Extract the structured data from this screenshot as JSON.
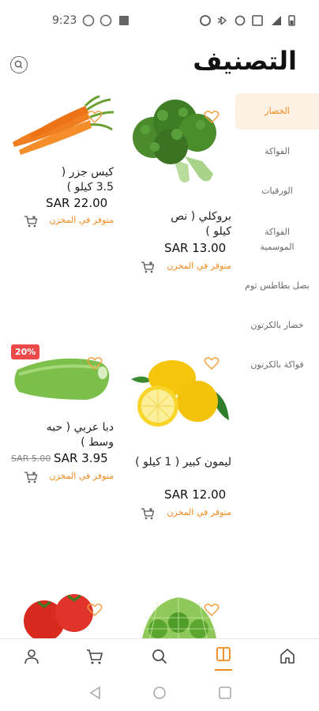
{
  "status_bar": {
    "time": "9:23"
  },
  "header": {
    "title": "التصنيف"
  },
  "categories": [
    {
      "label": "الخضار",
      "active": true
    },
    {
      "label": "الفواكة"
    },
    {
      "label": "الورقيات"
    },
    {
      "label": "الفواكة الموسمية"
    },
    {
      "label": "بصل بطاطس ثوم"
    },
    {
      "label": "خضار بالكرتون"
    },
    {
      "label": "فواكة بالكرتون"
    }
  ],
  "products": [
    {
      "name": "بروكلي ( نص كيلو )",
      "price": "SAR 13.00",
      "stock": "متوفر في المخزن"
    },
    {
      "name": "كيس جزر ( 3.5 كيلو )",
      "price": "SAR 22.00",
      "stock": "متوفر في المخزن"
    },
    {
      "name": "ليمون كبير ( 1 كيلو )",
      "price": "SAR 12.00",
      "stock": "متوفر في المخزن"
    },
    {
      "name": "دبا عربي ( حبه وسط )",
      "price": "SAR 3.95",
      "old_price": "SAR 5.00",
      "badge": "20%",
      "stock": "متوفر في المخزن"
    }
  ],
  "colors": {
    "accent": "#f08a1c",
    "badge": "#ec4a4a",
    "active_bg": "#fdf1e4"
  },
  "bottom_nav": [
    "profile-icon",
    "cart-icon",
    "search-icon",
    "catalog-icon",
    "home-icon"
  ]
}
